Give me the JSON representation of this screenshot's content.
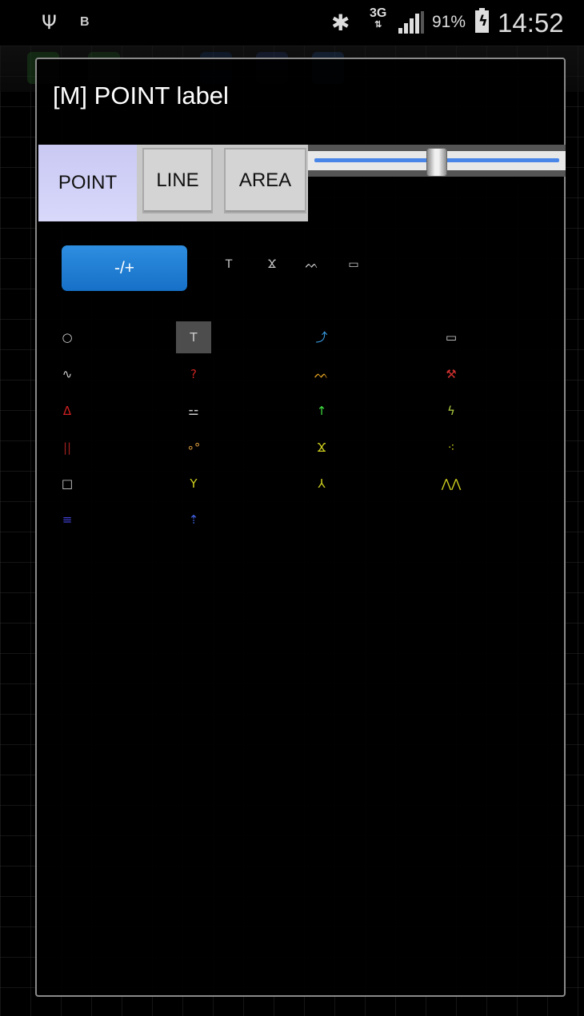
{
  "status_bar": {
    "usb_icon": "usb-icon",
    "b_indicator": "B",
    "bluetooth_icon": "bluetooth-icon",
    "network": "3G",
    "network_arrows": "⇅",
    "battery_percent": "91%",
    "time": "14:52"
  },
  "dialog": {
    "title": "[M] POINT label",
    "type_buttons": {
      "point": "POINT",
      "line": "LINE",
      "area": "AREA",
      "selected": "POINT"
    },
    "slider_level": 0.5,
    "toggle_label": "-/+",
    "recent_symbols": [
      {
        "icon": "t-symbol-icon",
        "glyph": "T",
        "color": "#cccccc"
      },
      {
        "icon": "y-split-symbol-icon",
        "glyph": "Ϫ",
        "color": "#cccccc"
      },
      {
        "icon": "peaks-symbol-icon",
        "glyph": "ᨓ",
        "color": "#cccccc"
      },
      {
        "icon": "box-symbol-icon",
        "glyph": "▭",
        "color": "#cccccc"
      }
    ],
    "symbols": [
      {
        "icon": "circle-symbol-icon",
        "glyph": "○",
        "color": "#cfcfcf"
      },
      {
        "icon": "t-symbol-icon",
        "glyph": "T",
        "color": "#cfcfcf",
        "selected": true
      },
      {
        "icon": "arrow-curve-symbol-icon",
        "glyph": "⤴",
        "color": "#3aa0e8"
      },
      {
        "icon": "box-symbol-icon",
        "glyph": "▭",
        "color": "#cfcfcf"
      },
      {
        "icon": "wave-symbol-icon",
        "glyph": "∿",
        "color": "#cfcfcf"
      },
      {
        "icon": "question-symbol-icon",
        "glyph": "?",
        "color": "#cc2222"
      },
      {
        "icon": "peaks-symbol-icon",
        "glyph": "ᨓ",
        "color": "#e0a020"
      },
      {
        "icon": "crossed-tools-symbol-icon",
        "glyph": "⚒",
        "color": "#d03030"
      },
      {
        "icon": "triangle-symbol-icon",
        "glyph": "Δ",
        "color": "#d02020"
      },
      {
        "icon": "dashes-symbol-icon",
        "glyph": "⚍",
        "color": "#cfcfcf"
      },
      {
        "icon": "up-arrow-symbol-icon",
        "glyph": "↑",
        "color": "#40e040"
      },
      {
        "icon": "zigzag-symbol-icon",
        "glyph": "ϟ",
        "color": "#b0d040"
      },
      {
        "icon": "double-line-symbol-icon",
        "glyph": "||",
        "color": "#a02020"
      },
      {
        "icon": "circles-symbol-icon",
        "glyph": "∘°",
        "color": "#e0a040"
      },
      {
        "icon": "y-split-symbol-icon",
        "glyph": "Ϫ",
        "color": "#d0d020"
      },
      {
        "icon": "dots-triangle-symbol-icon",
        "glyph": "⁖",
        "color": "#d0d020"
      },
      {
        "icon": "square-symbol-icon",
        "glyph": "□",
        "color": "#cfcfcf"
      },
      {
        "icon": "y-symbol-icon",
        "glyph": "Y",
        "color": "#d0d020"
      },
      {
        "icon": "inverted-y-symbol-icon",
        "glyph": "⅄",
        "color": "#d0d020"
      },
      {
        "icon": "zigzag-line-symbol-icon",
        "glyph": "⋀⋀",
        "color": "#d0d020"
      },
      {
        "icon": "water-dashes-symbol-icon",
        "glyph": "≡",
        "color": "#4040d0"
      },
      {
        "icon": "arrow-wavy-symbol-icon",
        "glyph": "⇡",
        "color": "#4060e0"
      }
    ]
  }
}
